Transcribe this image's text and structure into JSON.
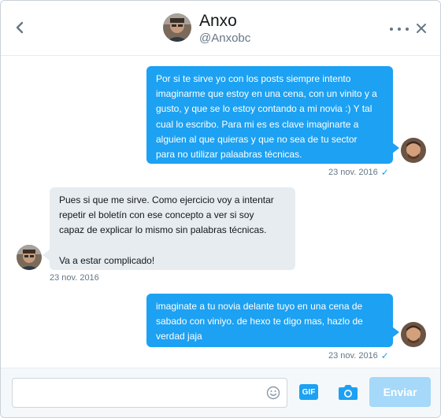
{
  "header": {
    "name": "Anxo",
    "handle": "@Anxobc",
    "back_icon": "chevron-left-icon",
    "more_icon": "more-horizontal-icon",
    "close_icon": "close-icon"
  },
  "messages": [
    {
      "direction": "out",
      "lines": [
        "Por si te sirve yo con los posts siempre intento",
        "imaginarme que estoy en una cena, con un vinito y a",
        "gusto, y que se lo estoy contando a mi novia :) Y tal",
        "cual lo escribo. Para mi es es clave imaginarte a",
        "alguien al que quieras y que no sea de tu sector",
        "para no utilizar palaabras técnicas."
      ],
      "timestamp": "23 nov. 2016",
      "read": "✓"
    },
    {
      "direction": "in",
      "lines": [
        "Pues si que me sirve. Como ejercicio voy a intentar",
        "repetir el boletín con ese concepto a ver si soy",
        "capaz de explicar lo mismo sin palabras técnicas.",
        "",
        "Va a estar complicado!"
      ],
      "timestamp": "23 nov. 2016"
    },
    {
      "direction": "out",
      "lines": [
        "imaginate a tu novia delante tuyo en una cena de",
        "sabado con viniyo. de hexo te digo mas, hazlo de",
        "verdad jaja"
      ],
      "timestamp": "23 nov. 2016",
      "read": "✓"
    }
  ],
  "composer": {
    "placeholder": "",
    "gif_label": "GIF",
    "send_label": "Enviar",
    "emoji_icon": "emoji-icon",
    "camera_icon": "camera-icon"
  },
  "colors": {
    "accent": "#1da1f2",
    "incoming_bubble": "#e6ecf0",
    "send_disabled": "#a5d8f9",
    "muted_text": "#657786"
  }
}
